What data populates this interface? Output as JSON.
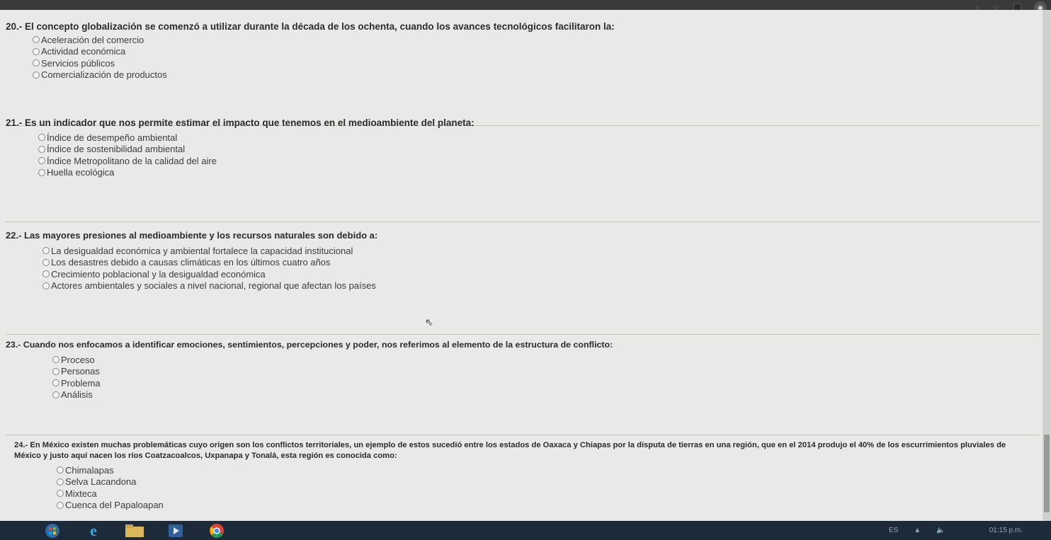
{
  "questions": [
    {
      "text": "20.- El concepto globalización se comenzó a utilizar durante la década de los ochenta, cuando los avances tecnológicos facilitaron la:",
      "options": [
        "Aceleración del comercio",
        "Actividad económica",
        "Servicios públicos",
        "Comercialización de productos"
      ]
    },
    {
      "text": "21.- Es un indicador que nos permite estimar el impacto que tenemos en el medioambiente del planeta:",
      "options": [
        "Índice de desempeño ambiental",
        "Índice de sostenibilidad ambiental",
        "Índice Metropolitano de la calidad del aire",
        "Huella ecológica"
      ]
    },
    {
      "text": "22.- Las mayores presiones al medioambiente y los recursos naturales son debido a:",
      "options": [
        "La desigualdad económica y ambiental fortalece la capacidad institucional",
        "Los desastres debido a causas climáticas en los últimos cuatro años",
        "Crecimiento poblacional y la desigualdad económica",
        "Actores ambientales y sociales a nivel nacional, regional que afectan los países"
      ]
    },
    {
      "text": "23.- Cuando nos enfocamos a identificar emociones, sentimientos, percepciones y poder, nos referimos al elemento de la estructura de conflicto:",
      "options": [
        "Proceso",
        "Personas",
        "Problema",
        "Análisis"
      ]
    },
    {
      "text": "24.- En México existen muchas problemáticas cuyo origen son los conflictos territoriales, un ejemplo de estos sucedió entre los estados de Oaxaca y Chiapas por la disputa de tierras en una región, que en el 2014 produjo el 40% de los escurrimientos pluviales de México y justo aquí nacen los ríos Coatzacoalcos, Uxpanapa y Tonalá, esta región es conocida como:",
      "options": [
        "Chimalapas",
        "Selva Lacandona",
        "Mixteca",
        "Cuenca del Papaloapan"
      ]
    }
  ],
  "taskbar": {
    "language": "ES",
    "clock": "01:15 p.m."
  },
  "icons": {
    "browser": [
      "search-icon",
      "star-icon",
      "window-icon",
      "profile-icon"
    ],
    "taskbar": [
      "windows-start-icon",
      "internet-explorer-icon",
      "file-explorer-icon",
      "media-player-icon",
      "chrome-icon"
    ]
  },
  "colors": {
    "page_bg": "#e9e9e7",
    "taskbar_bg": "#1c2a3a"
  }
}
